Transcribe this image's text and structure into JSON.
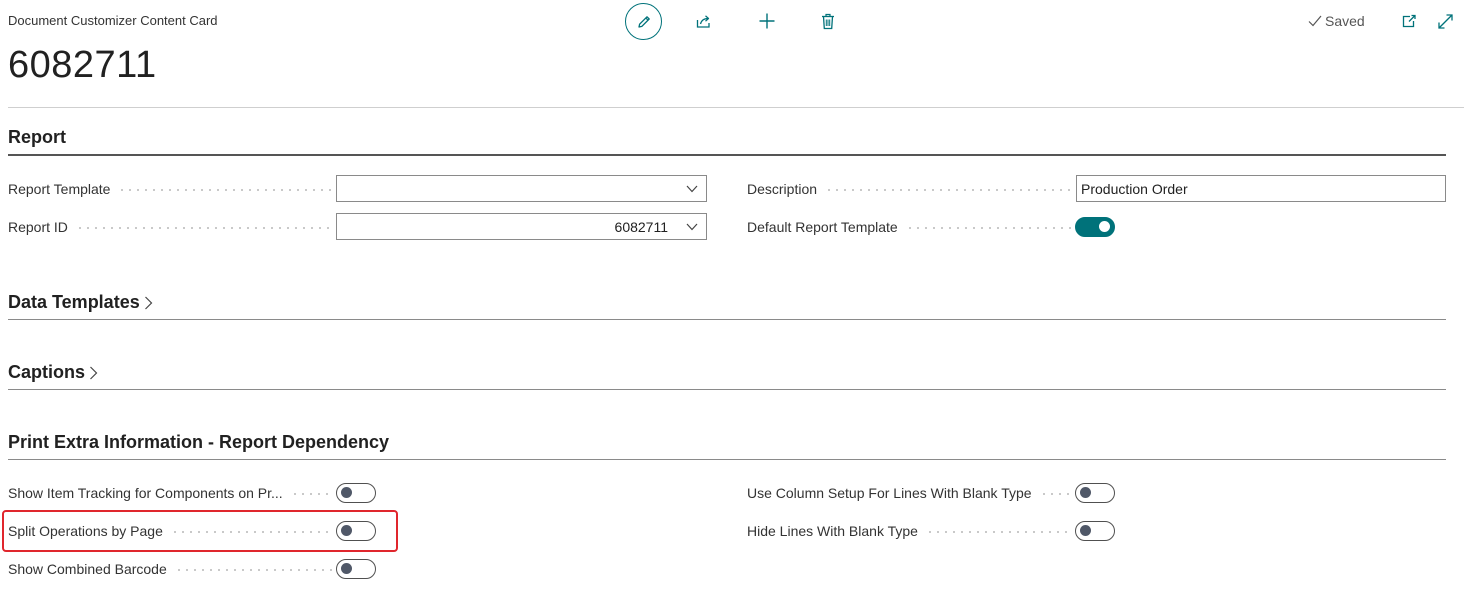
{
  "header": {
    "caption": "Document Customizer Content Card",
    "record_title": "6082711",
    "saved_label": "Saved"
  },
  "actions": {
    "edit": "pencil-icon",
    "share": "share-icon",
    "new": "plus-icon",
    "delete": "trash-icon",
    "open_new_window": "open-in-new-window-icon",
    "expand": "expand-icon"
  },
  "sections": {
    "report": {
      "title": "Report",
      "fields": {
        "report_template": {
          "label": "Report Template",
          "value": ""
        },
        "report_id": {
          "label": "Report ID",
          "value": "6082711"
        },
        "description": {
          "label": "Description",
          "value": "Production Order"
        },
        "default_report_template": {
          "label": "Default Report Template",
          "value": true
        }
      }
    },
    "data_templates": {
      "title": "Data Templates"
    },
    "captions": {
      "title": "Captions"
    },
    "print_extra": {
      "title": "Print Extra Information - Report Dependency",
      "fields": {
        "show_item_tracking": {
          "label": "Show Item Tracking for Components on Pr...",
          "value": false
        },
        "split_operations": {
          "label": "Split Operations by Page",
          "value": false
        },
        "show_combined_barcode": {
          "label": "Show Combined Barcode",
          "value": false
        },
        "use_column_setup": {
          "label": "Use Column Setup For Lines With Blank Type",
          "value": false
        },
        "hide_lines_blank": {
          "label": "Hide Lines With Blank Type",
          "value": false
        }
      }
    }
  },
  "colors": {
    "accent": "#00727a",
    "highlight": "#e0262d"
  }
}
